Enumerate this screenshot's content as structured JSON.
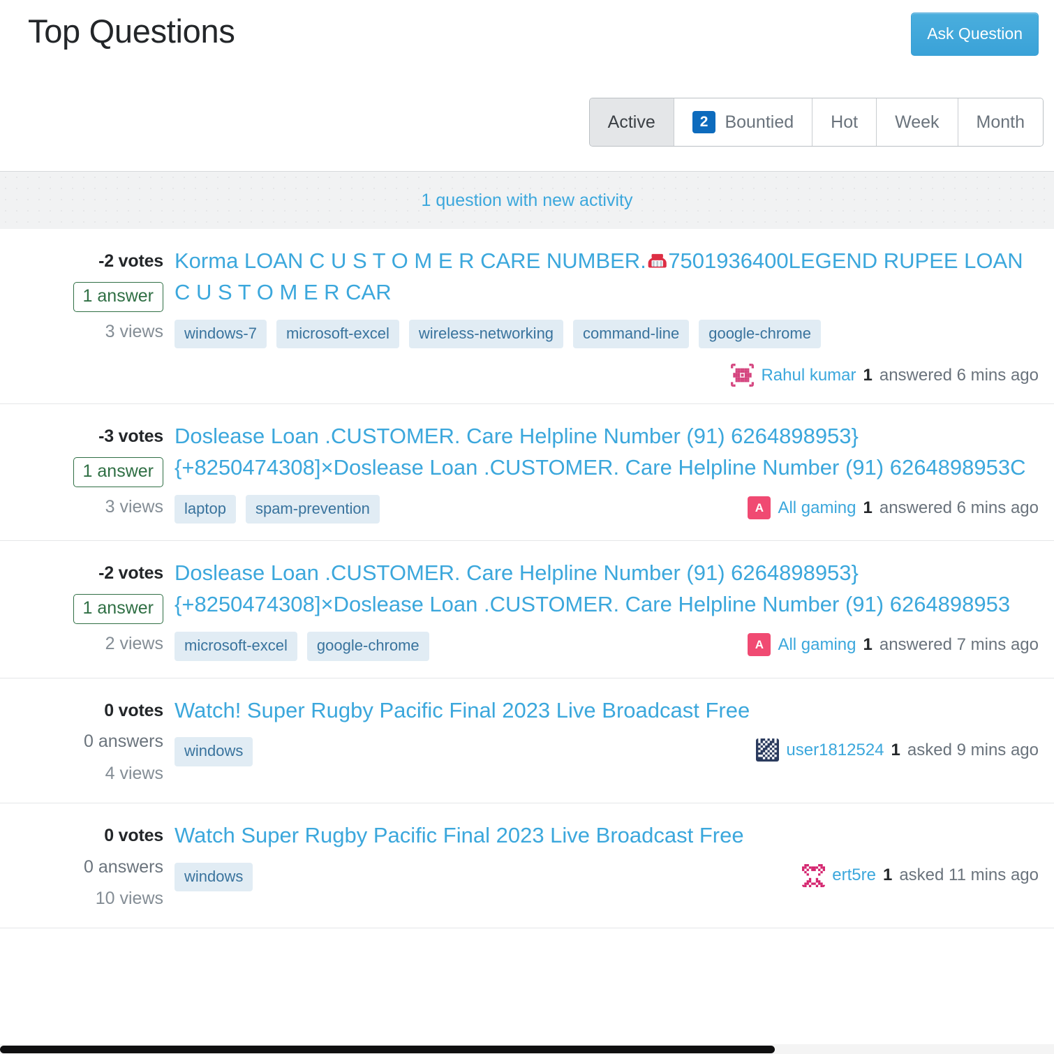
{
  "header": {
    "title": "Top Questions",
    "ask_button": "Ask Question"
  },
  "tabs": [
    {
      "label": "Active",
      "badge": null,
      "active": true
    },
    {
      "label": "Bountied",
      "badge": "2",
      "active": false
    },
    {
      "label": "Hot",
      "badge": null,
      "active": false
    },
    {
      "label": "Week",
      "badge": null,
      "active": false
    },
    {
      "label": "Month",
      "badge": null,
      "active": false
    }
  ],
  "activity_banner": {
    "text": "1 question with new activity"
  },
  "colors": {
    "link": "#3ba7dc",
    "accent_button": "#3ba7dc",
    "tag_bg": "#e1ecf4",
    "tag_text": "#39739d",
    "badge_blue": "#0d6bbd",
    "answered_green": "#2f6f44"
  },
  "questions": [
    {
      "votes": "-2 votes",
      "answers": "1 answer",
      "answers_highlighted": true,
      "views": "3 views",
      "title_part1": "Korma LOAN C U S T O M E R CARE NUMBER.",
      "title_emoji": "telephone-emoji",
      "title_part2": "7501936400LEGEND RUPEE LOAN C U S T O M E R CAR",
      "tags": [
        "windows-7",
        "microsoft-excel",
        "wireless-networking",
        "command-line",
        "google-chrome"
      ],
      "user": {
        "avatar": "identicon-pink",
        "name": "Rahul kumar",
        "reputation": "1",
        "action": "answered 6 mins ago"
      }
    },
    {
      "votes": "-3 votes",
      "answers": "1 answer",
      "answers_highlighted": true,
      "views": "3 views",
      "title_part1": "Doslease Loan .CUSTOMER. Care Helpline Number (91) 6264898953}{+8250474308]×Doslease Loan .CUSTOMER. Care Helpline Number (91) 6264898953C",
      "title_emoji": null,
      "title_part2": "",
      "tags": [
        "laptop",
        "spam-prevention"
      ],
      "user": {
        "avatar": "letter-A",
        "name": "All gaming",
        "reputation": "1",
        "action": "answered 6 mins ago"
      }
    },
    {
      "votes": "-2 votes",
      "answers": "1 answer",
      "answers_highlighted": true,
      "views": "2 views",
      "title_part1": "Doslease Loan .CUSTOMER. Care Helpline Number (91) 6264898953}{+8250474308]×Doslease Loan .CUSTOMER. Care Helpline Number (91) 6264898953",
      "title_emoji": null,
      "title_part2": "",
      "tags": [
        "microsoft-excel",
        "google-chrome"
      ],
      "user": {
        "avatar": "letter-A",
        "name": "All gaming",
        "reputation": "1",
        "action": "answered 7 mins ago"
      }
    },
    {
      "votes": "0 votes",
      "answers": "0 answers",
      "answers_highlighted": false,
      "views": "4 views",
      "title_part1": "Watch! Super Rugby Pacific Final 2023 Live Broadcast Free",
      "title_emoji": null,
      "title_part2": "",
      "tags": [
        "windows"
      ],
      "user": {
        "avatar": "identicon-navy",
        "name": "user1812524",
        "reputation": "1",
        "action": "asked 9 mins ago"
      }
    },
    {
      "votes": "0 votes",
      "answers": "0 answers",
      "answers_highlighted": false,
      "views": "10 views",
      "title_part1": "Watch Super Rugby Pacific Final 2023 Live Broadcast Free",
      "title_emoji": null,
      "title_part2": "",
      "tags": [
        "windows"
      ],
      "user": {
        "avatar": "identicon-magenta",
        "name": "ert5re",
        "reputation": "1",
        "action": "asked 11 mins ago"
      }
    }
  ]
}
